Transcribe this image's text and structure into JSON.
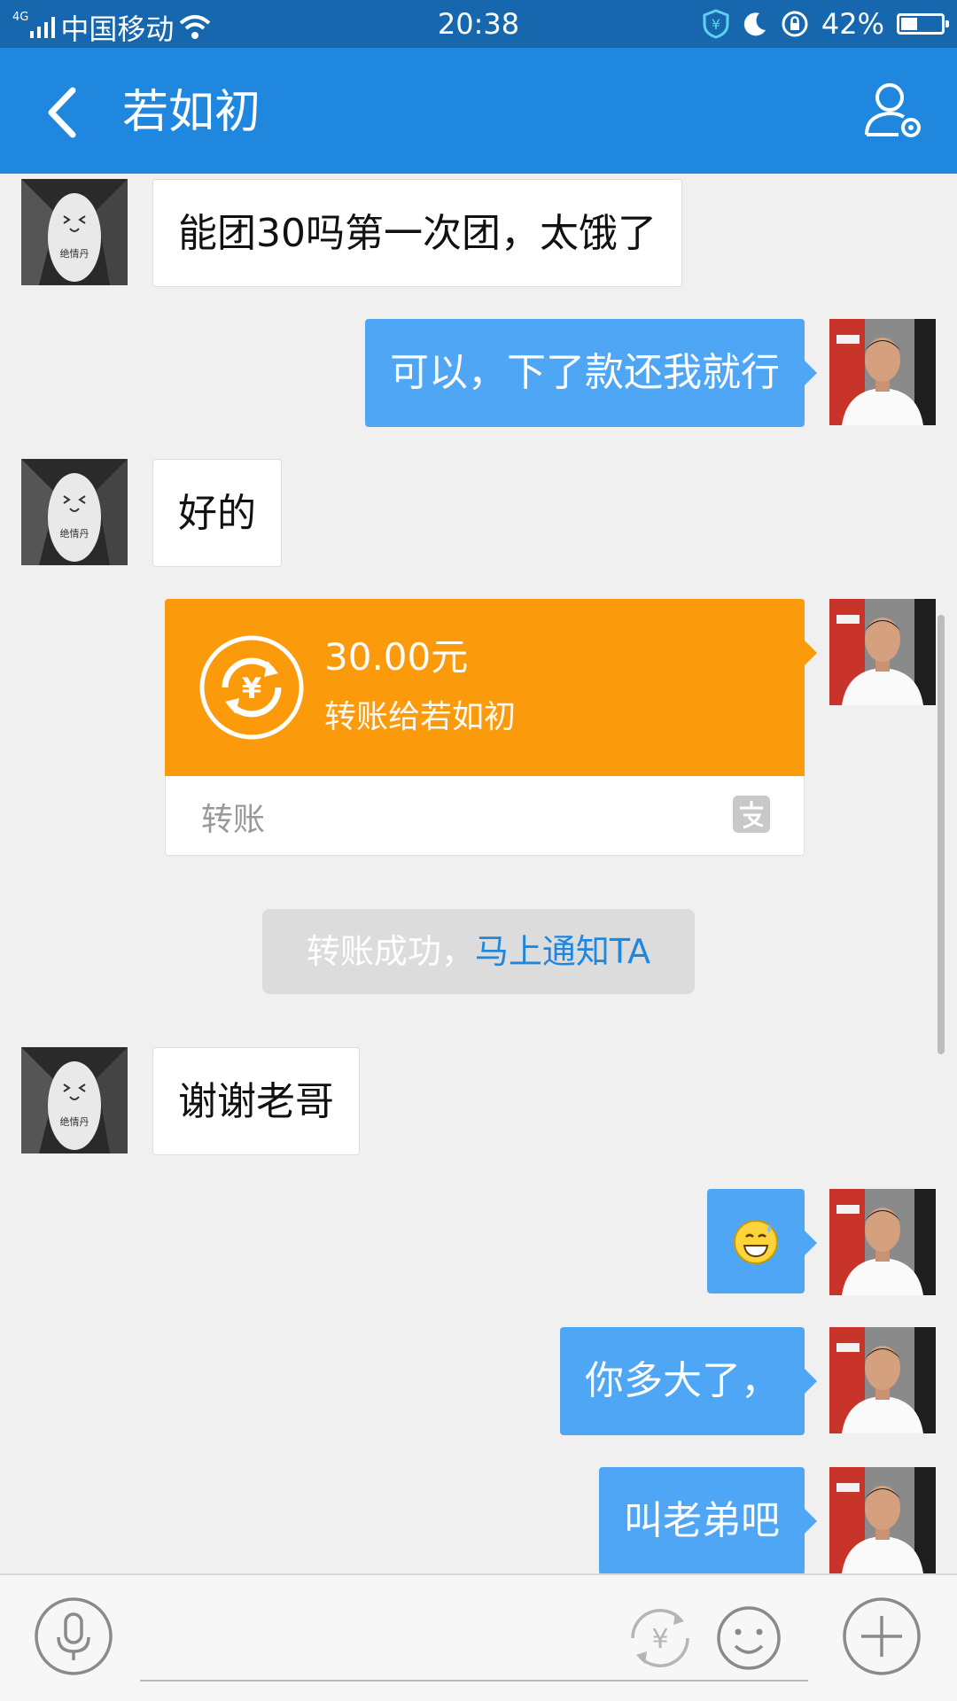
{
  "status_bar": {
    "network": "4G",
    "carrier": "中国移动",
    "time": "20:38",
    "battery": "42%",
    "battery_level": 0.42
  },
  "header": {
    "title": "若如初"
  },
  "messages": [
    {
      "direction": "in",
      "text": "能团30吗第一次团，太饿了"
    },
    {
      "direction": "out",
      "text": "可以，下了款还我就行"
    },
    {
      "direction": "in",
      "text": "好的"
    },
    {
      "direction": "out",
      "type": "transfer"
    },
    {
      "direction": "in",
      "text": "谢谢老哥"
    },
    {
      "direction": "out",
      "type": "emoji",
      "emoji": "grinning-sweat-emoji"
    },
    {
      "direction": "out",
      "text": "你多大了，"
    },
    {
      "direction": "out",
      "text": "叫老弟吧"
    }
  ],
  "transfer": {
    "amount": "30.00元",
    "description": "转账给若如初",
    "label": "转账"
  },
  "system_note": {
    "text": "转账成功，",
    "link": "马上通知TA"
  },
  "avatars": {
    "contact_caption": "绝情丹"
  },
  "colors": {
    "status_bar": "#1667ad",
    "title_bar": "#1f88de",
    "outgoing_bubble": "#4ea6f4",
    "transfer_card": "#fb9a0b",
    "link": "#1f88de",
    "background": "#f0f0f0"
  },
  "icons": {
    "back": "back-arrow-icon",
    "profile": "user-settings-icon",
    "voice": "microphone-icon",
    "transfer": "yuan-transfer-icon",
    "emoji": "smiley-icon",
    "more": "plus-icon"
  }
}
